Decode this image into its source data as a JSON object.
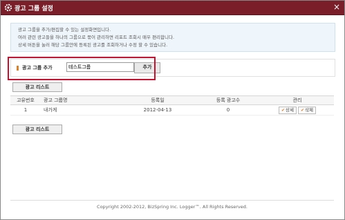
{
  "window": {
    "title": "광고 그룹 설정",
    "close": "×"
  },
  "info": {
    "line1": "광고 그룹을 추가/편집할 수 있는 설정화면입니다.",
    "line2": "여러 관련 광고들을 하나의 그룹으로 묶어 관리하면 리포트 조회시 매우 편리합니다.",
    "line3": "상세 버튼을 눌러 해당 그룹안에 등록된 광고를 조회하거나 수정 할 수 있습니다."
  },
  "group": {
    "label": "광고 그룹 추가",
    "input_value": "테스트그룹",
    "add_label": "추가"
  },
  "list_button": "광고 리스트",
  "table": {
    "headers": [
      "고유번호",
      "광고 그룹명",
      "등록일",
      "등록 광고수",
      "관리"
    ],
    "rows": [
      {
        "id": "1",
        "name": "내가게",
        "date": "2012-04-13",
        "count": "0",
        "detail": "상세",
        "delete": "삭제"
      }
    ]
  },
  "footer": "Copyright 2002-2012, BizSpring Inc. Logger™. All Rights Reserved.",
  "colors": {
    "titlebar": "#7a1f2a",
    "highlight": "#c8102e",
    "accent": "#d9822b"
  }
}
